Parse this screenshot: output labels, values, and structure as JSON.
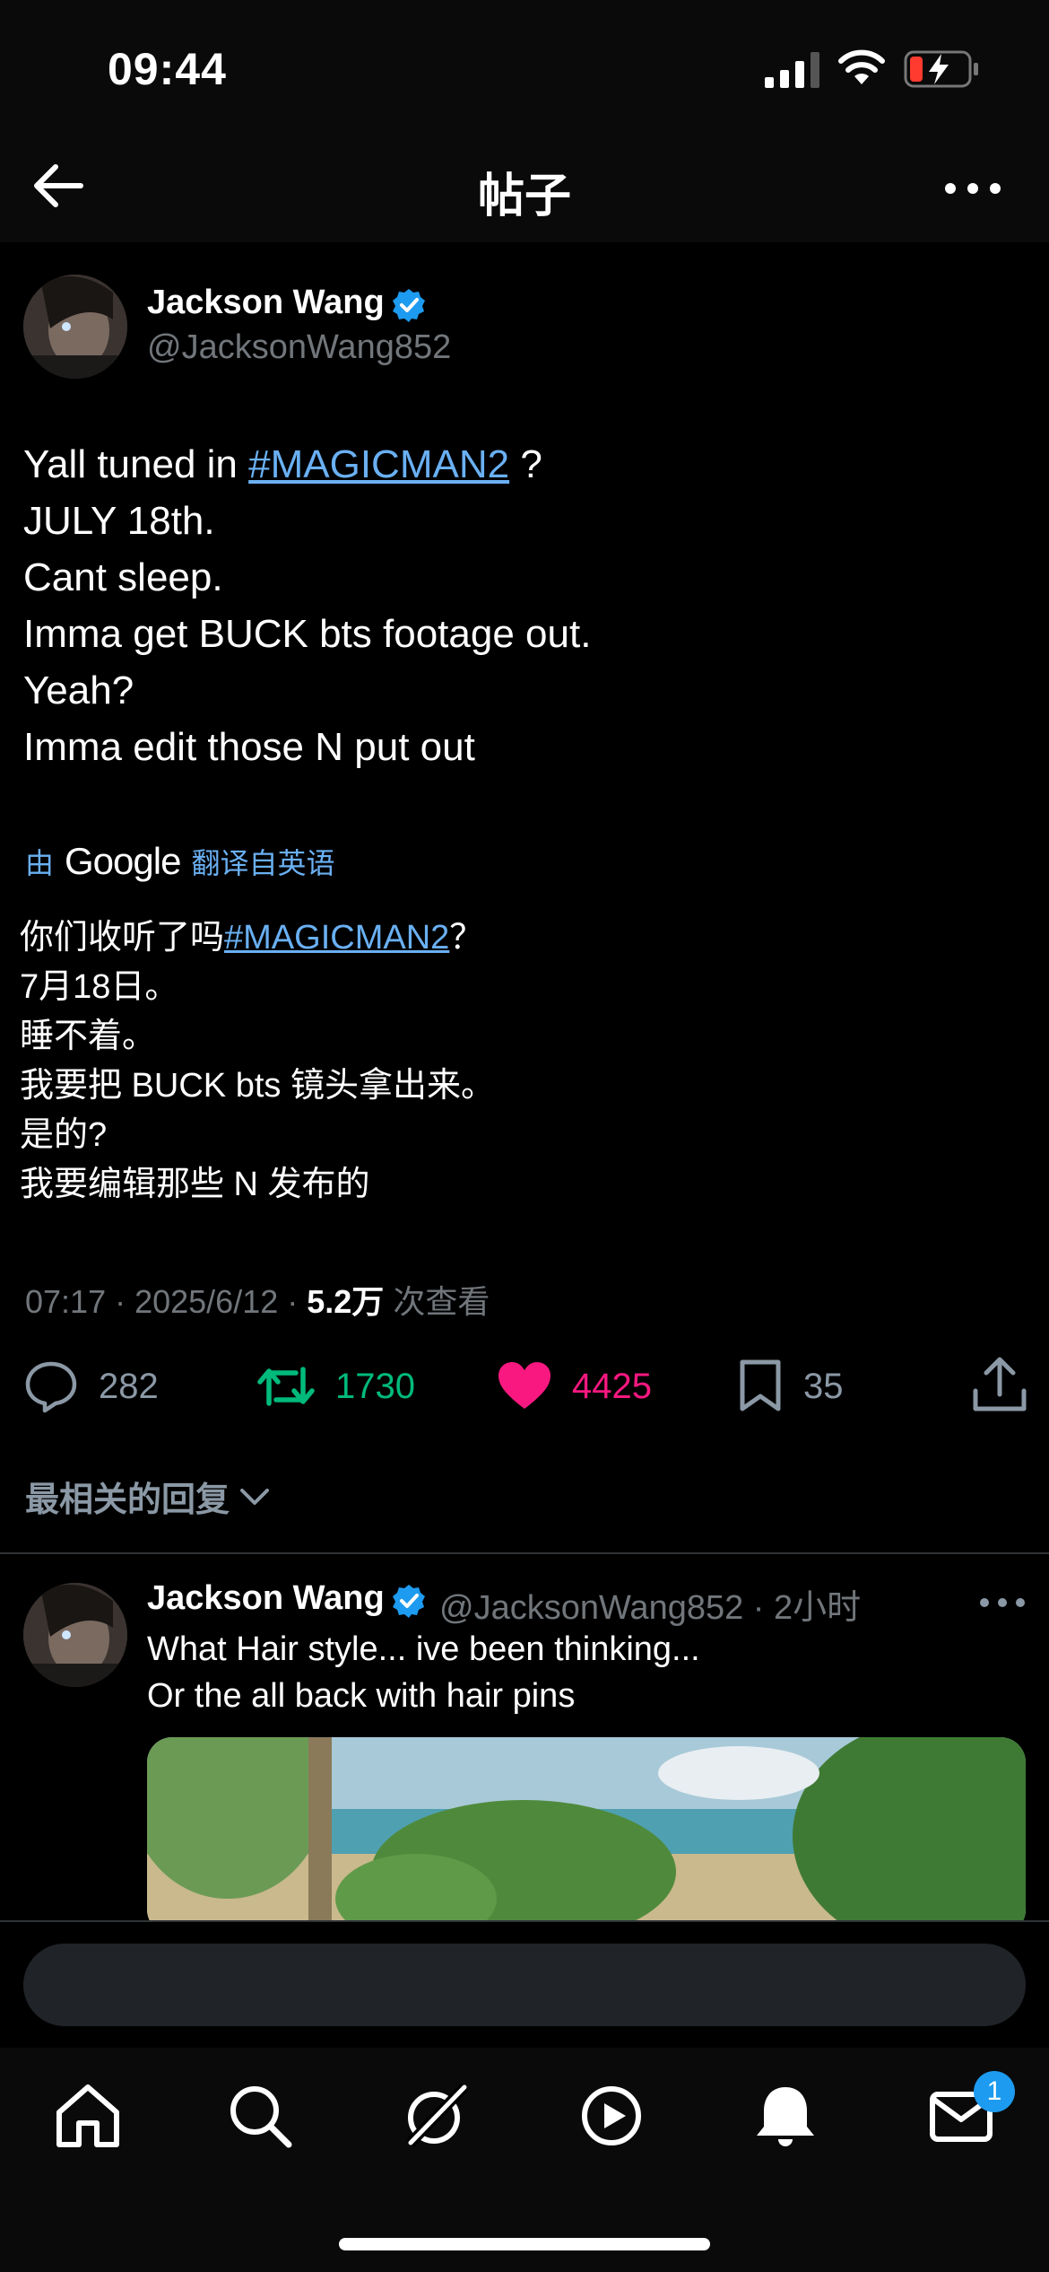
{
  "status_bar": {
    "time": "09:44"
  },
  "header": {
    "title": "帖子"
  },
  "tweet": {
    "author_name": "Jackson Wang",
    "author_handle": "@JacksonWang852",
    "line1_prefix": "Yall tuned in ",
    "line1_hashtag": "#MAGICMAN2",
    "line1_suffix": " ?",
    "line2": "JULY 18th.",
    "line3": "Cant sleep.",
    "line4": "Imma get BUCK bts footage out.",
    "line5": "Yeah?",
    "line6": "Imma edit those N put out"
  },
  "translation": {
    "by_label": "由",
    "provider": "Google",
    "from_label": "翻译自英语",
    "line1_prefix": "你们收听了吗",
    "line1_hashtag": "#MAGICMAN2",
    "line1_suffix": "？",
    "line2": "7月18日。",
    "line3": "睡不着。",
    "line4": "我要把 BUCK bts 镜头拿出来。",
    "line5": "是的?",
    "line6": "我要编辑那些 N 发布的"
  },
  "meta": {
    "time": "07:17",
    "date": "2025/6/12",
    "views": "5.2万",
    "views_label": "次查看"
  },
  "actions": {
    "replies": "282",
    "retweets": "1730",
    "likes": "4425",
    "bookmarks": "35"
  },
  "replies_section": {
    "label": "最相关的回复"
  },
  "reply": {
    "author_name": "Jackson Wang",
    "author_handle": "@JacksonWang852",
    "time": "2小时",
    "line1": "What Hair style... ive been thinking...",
    "line2": "Or the all back with hair pins"
  },
  "compose": {
    "placeholder": ""
  },
  "tab_bar": {
    "icons": [
      "home-icon",
      "search-icon",
      "grok-icon",
      "video-icon",
      "notifications-icon",
      "messages-icon"
    ],
    "messages_badge": "1"
  },
  "colors": {
    "accent": "#1d9bf0",
    "hashtag": "#6ab0f3",
    "retweet": "#00ba7c",
    "like": "#f91880",
    "muted": "#71767b"
  }
}
